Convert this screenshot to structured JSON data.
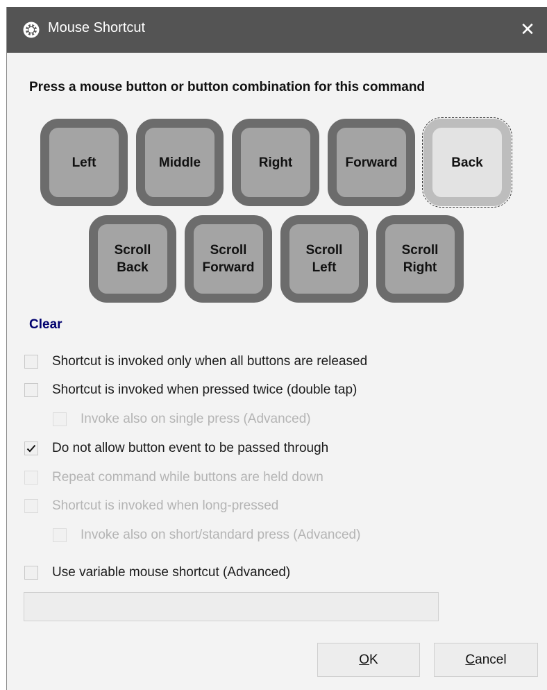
{
  "window": {
    "title": "Mouse Shortcut",
    "close_glyph": "✕",
    "app_icon": "gear-icon"
  },
  "prompt": "Press a mouse button or button combination for this command",
  "mouse_buttons": [
    {
      "label": "Left",
      "selected": false
    },
    {
      "label": "Middle",
      "selected": false
    },
    {
      "label": "Right",
      "selected": false
    },
    {
      "label": "Forward",
      "selected": false
    },
    {
      "label": "Back",
      "selected": true
    },
    {
      "label": "Scroll\nBack",
      "selected": false
    },
    {
      "label": "Scroll\nForward",
      "selected": false
    },
    {
      "label": "Scroll\nLeft",
      "selected": false
    },
    {
      "label": "Scroll\nRight",
      "selected": false
    }
  ],
  "clear_label": "Clear",
  "options": [
    {
      "label": "Shortcut is invoked only when all buttons are released",
      "checked": false,
      "enabled": true
    },
    {
      "label": "Shortcut is invoked when pressed twice (double tap)",
      "checked": false,
      "enabled": true
    },
    {
      "label": "Invoke also on single press (Advanced)",
      "checked": false,
      "enabled": false
    },
    {
      "label": "Do not allow button event to be passed through",
      "checked": true,
      "enabled": true
    },
    {
      "label": "Repeat command while buttons are held down",
      "checked": false,
      "enabled": false
    },
    {
      "label": "Shortcut is invoked when long-pressed",
      "checked": false,
      "enabled": false
    },
    {
      "label": "Invoke also on short/standard press (Advanced)",
      "checked": false,
      "enabled": false
    },
    {
      "label": "Use variable mouse shortcut (Advanced)",
      "checked": false,
      "enabled": true
    }
  ],
  "variable_field": {
    "value": ""
  },
  "buttons": {
    "ok": {
      "mnemonic": "O",
      "rest": "K"
    },
    "cancel": {
      "mnemonic": "C",
      "rest": "ancel"
    }
  },
  "colors": {
    "titlebar": "#545454",
    "link": "#00006e",
    "button_fill": "#a4a4a4",
    "button_border": "#6c6c6c"
  }
}
